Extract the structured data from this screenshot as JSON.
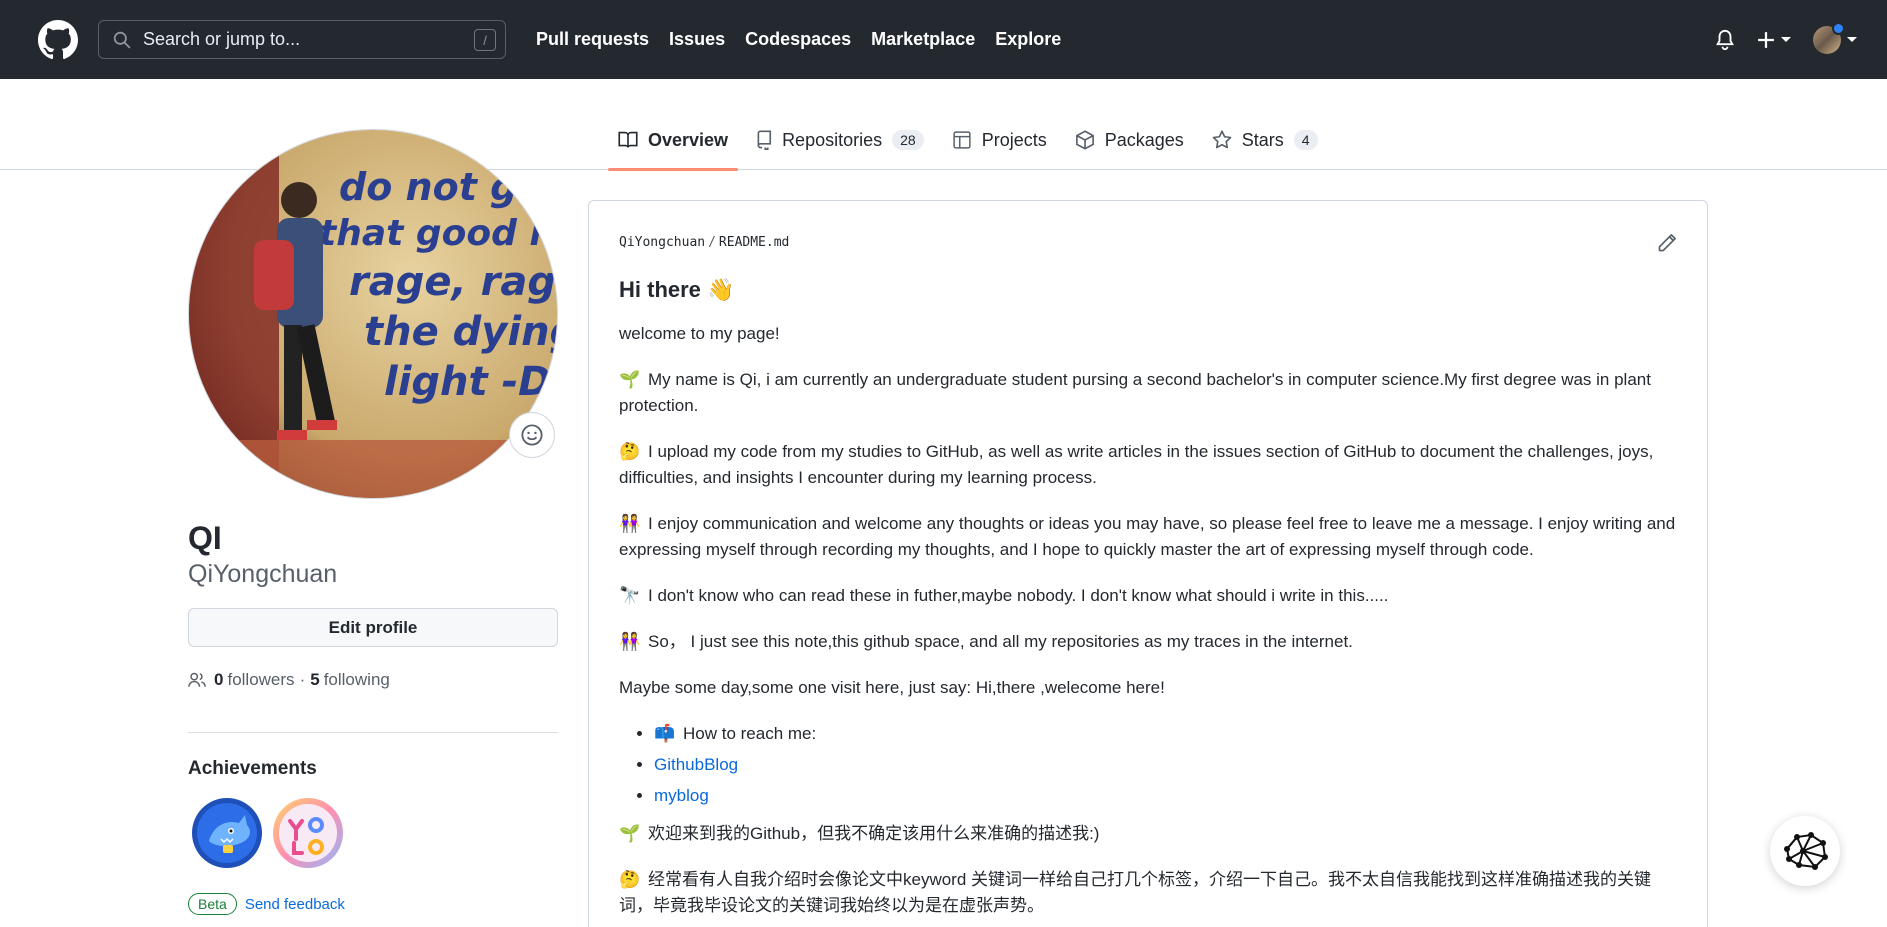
{
  "header": {
    "search_placeholder": "Search or jump to...",
    "search_shortcut": "/",
    "nav": [
      "Pull requests",
      "Issues",
      "Codespaces",
      "Marketplace",
      "Explore"
    ]
  },
  "tabs": [
    {
      "label": "Overview",
      "active": true
    },
    {
      "label": "Repositories",
      "count": "28"
    },
    {
      "label": "Projects"
    },
    {
      "label": "Packages"
    },
    {
      "label": "Stars",
      "count": "4"
    }
  ],
  "profile": {
    "name": "QI",
    "login": "QiYongchuan",
    "edit_label": "Edit profile",
    "followers_count": "0",
    "followers_label": "followers",
    "dot": "·",
    "following_count": "5",
    "following_label": "following",
    "avatar_text": "do not go g\nthat good nig\nrage, rage ag\nthe dying of t\nlight -Dylan"
  },
  "achievements": {
    "title": "Achievements",
    "beta_label": "Beta",
    "feedback_label": "Send feedback"
  },
  "readme": {
    "owner": "QiYongchuan",
    "file": "README.md",
    "heading": "Hi there 👋",
    "p1": "welcome to my page!",
    "p2": "My name is Qi, i am currently an undergraduate student pursing a second bachelor's in computer science.My first degree was in plant protection.",
    "p3": "I upload my code from my studies to GitHub, as well as write articles in the issues section of GitHub to document the challenges, joys, difficulties, and insights I encounter during my learning process.",
    "p4": "I enjoy communication and welcome any thoughts or ideas you may have, so please feel free to leave me a message. I enjoy writing and expressing myself through recording my thoughts, and I hope to quickly master the art of expressing myself through code.",
    "p5": "I don't know who can read these in futher,maybe nobody. I don't know what should i write in this.....",
    "p6": "So， I just see this note,this github space, and all my repositories as my traces in the internet.",
    "p7": "Maybe some day,some one visit here, just say: Hi,there ,welecome here!",
    "li1": "How to reach me:",
    "li2": "GithubBlog",
    "li3": "myblog",
    "p8": "欢迎来到我的Github，但我不确定该用什么来准确的描述我:)",
    "p9": "经常看有人自我介绍时会像论文中keyword 关键词一样给自己打几个标签，介绍一下自己。我不太自信我能找到这样准确描述我的关键词，毕竟我毕设论文的关键词我始终以为是在虚张声势。",
    "emoji_seedling": "🌱",
    "emoji_think": "🤔",
    "emoji_people": "👭",
    "emoji_telescope": "🔭",
    "emoji_mailbox": "📫"
  }
}
